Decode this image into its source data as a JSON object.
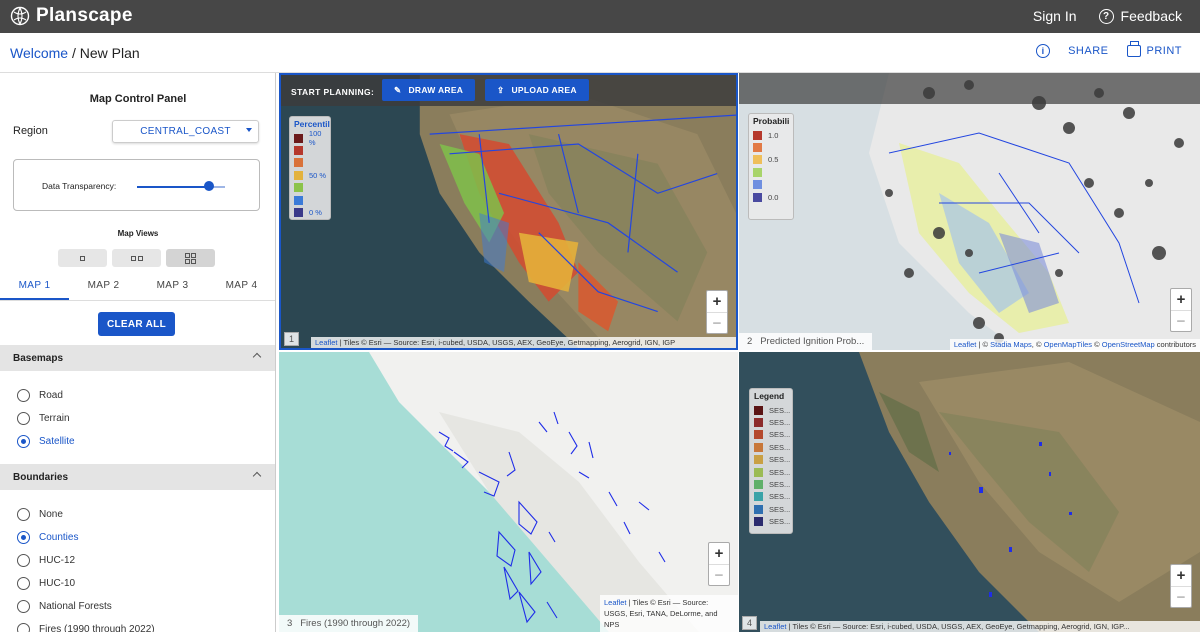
{
  "app": {
    "name": "Planscape"
  },
  "topnav": {
    "sign_in": "Sign In",
    "feedback": "Feedback"
  },
  "breadcrumb": {
    "root": "Welcome",
    "separator": " / ",
    "current": "New Plan"
  },
  "actions": {
    "share": "SHARE",
    "print": "PRINT"
  },
  "panel": {
    "title": "Map Control Panel",
    "region_label": "Region",
    "region_value": "CENTRAL_COAST",
    "transparency_label": "Data Transparency:",
    "transparency_value": 0.82,
    "map_views_label": "Map Views",
    "tabs": [
      "MAP 1",
      "MAP 2",
      "MAP 3",
      "MAP 4"
    ],
    "active_tab": "MAP 1",
    "clear_all": "CLEAR ALL",
    "basemaps": {
      "title": "Basemaps",
      "options": [
        "Road",
        "Terrain",
        "Satellite"
      ],
      "selected": "Satellite"
    },
    "boundaries": {
      "title": "Boundaries",
      "options": [
        "None",
        "Counties",
        "HUC-12",
        "HUC-10",
        "National Forests",
        "Fires (1990 through 2022)"
      ],
      "selected": "Counties"
    }
  },
  "planning": {
    "label": "START PLANNING:",
    "draw": "DRAW AREA",
    "upload": "UPLOAD AREA"
  },
  "maps": {
    "m1": {
      "number": "1",
      "legend_title": "Percentil",
      "legend_labels": [
        "100 %",
        "",
        "",
        "50 %",
        "",
        "",
        "0 %"
      ],
      "attribution_link": "Leaflet",
      "attribution": " | Tiles © Esri — Source: Esri, i-cubed, USDA, USGS, AEX, GeoEye, Getmapping, Aerogrid, IGN, IGP"
    },
    "m2": {
      "number": "2",
      "label": "Predicted Ignition Prob...",
      "legend_title": "Probabili",
      "legend_labels": [
        "1.0",
        "",
        "0.5",
        "",
        "",
        "0.0"
      ],
      "attribution_link": "Leaflet",
      "attribution_mid": " | © ",
      "attr_stadia": "Stadia Maps",
      "attr_omt": "OpenMapTiles",
      "attr_osm": "OpenStreetMap",
      "attribution_end": " contributors"
    },
    "m3": {
      "number": "3",
      "label": "Fires (1990 through 2022)",
      "attribution_link": "Leaflet",
      "attribution_line1": " | Tiles © Esri — Source:",
      "attribution_line2": "USGS, Esri, TANA, DeLorme, and",
      "attribution_line3": "NPS"
    },
    "m4": {
      "number": "4",
      "legend_title": "Legend",
      "legend_labels": [
        "SES...",
        "SES...",
        "SES...",
        "SES...",
        "SES...",
        "SES...",
        "SES...",
        "SES...",
        "SES...",
        "SES..."
      ],
      "attribution_link": "Leaflet",
      "attribution": " | Tiles © Esri — Source: Esri, i-cubed, USDA, USGS, AEX, GeoEye, Getmapping, Aerogrid, IGN, IGP..."
    }
  },
  "colors": {
    "accent": "#1a56c8",
    "percentile_ramp": [
      "#6b1a1a",
      "#b5382c",
      "#d9723a",
      "#e3b23c",
      "#8bc34a",
      "#3b7bd8",
      "#3a3a8a"
    ],
    "prob_ramp": [
      "#b5382c",
      "#e27a45",
      "#efbf5a",
      "#a8d46a",
      "#6f8fe0",
      "#4a4aa0"
    ],
    "ses_ramp": [
      "#5a1414",
      "#8c2b2b",
      "#b4492d",
      "#c8783a",
      "#c9a044",
      "#9bbb55",
      "#5fb06a",
      "#3aa3a8",
      "#2f6fb0",
      "#2b2b6e"
    ]
  }
}
